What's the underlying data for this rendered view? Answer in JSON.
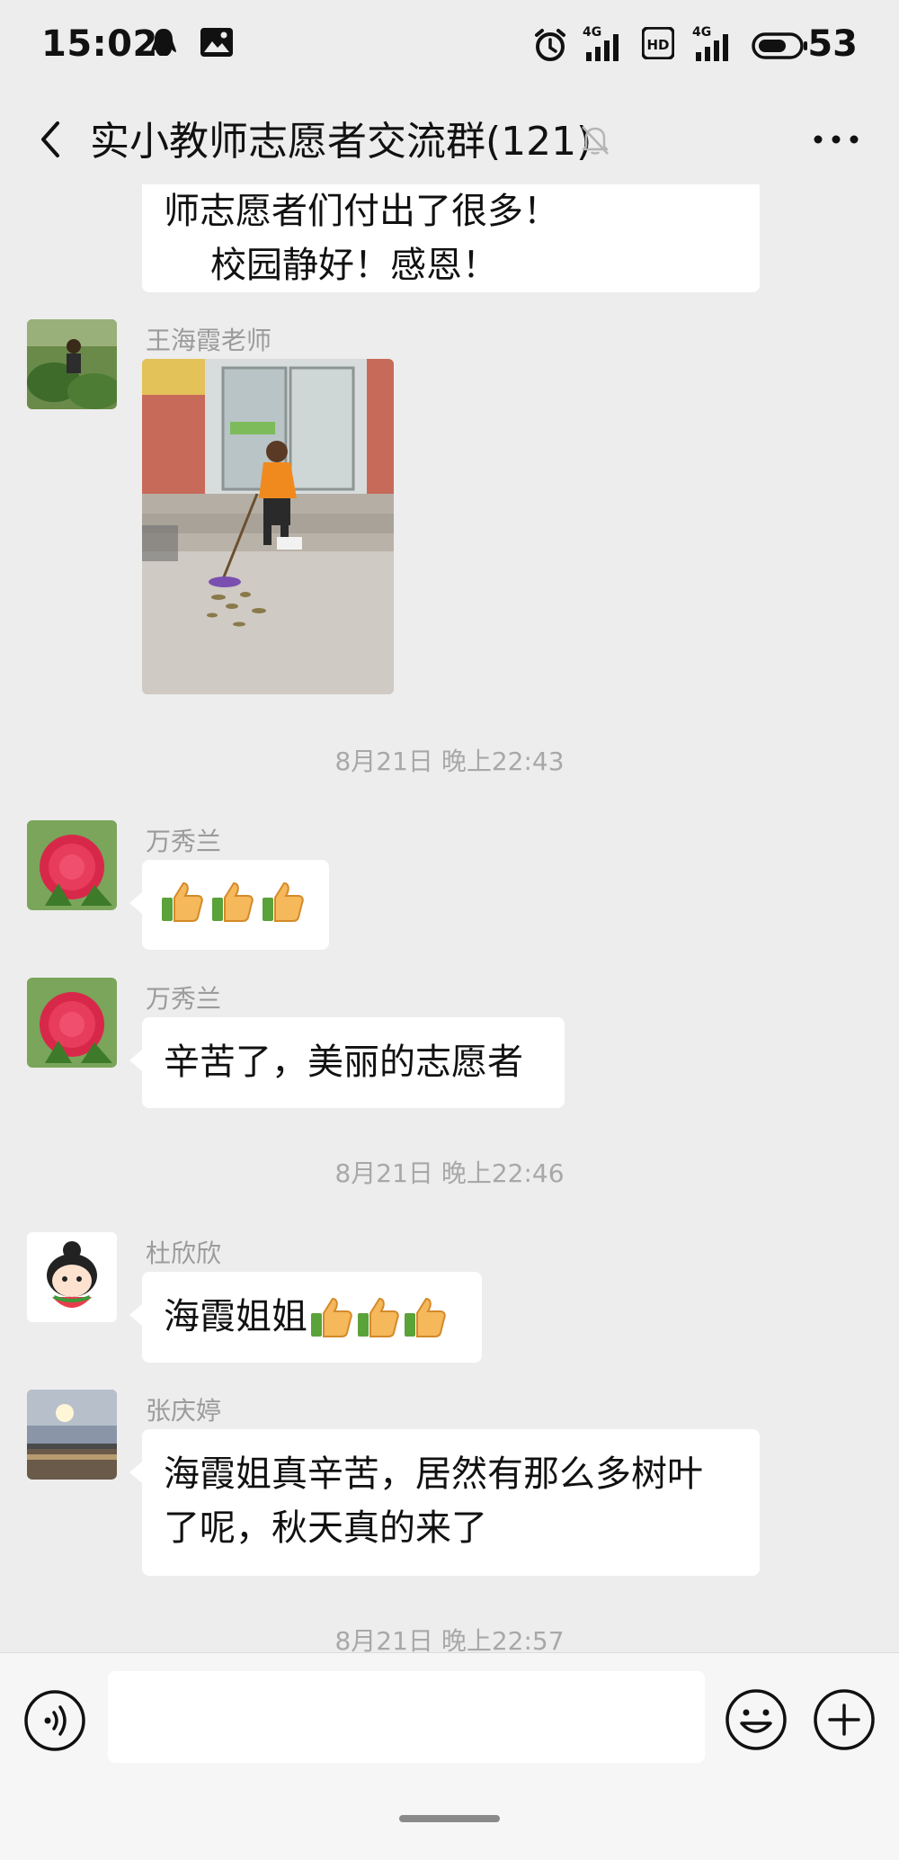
{
  "status_bar": {
    "time": "15:02",
    "network_1": "4G",
    "network_2": "4G",
    "hd": "HD",
    "battery": "53",
    "icons": [
      "qq-penguin-icon",
      "image-notify-icon",
      "alarm-icon",
      "signal-icon",
      "hd-icon",
      "signal-icon",
      "battery-icon"
    ]
  },
  "header": {
    "title": "实小教师志愿者交流群(121)",
    "back_icon": "chevron-left-icon",
    "mute_icon": "bell-off-icon",
    "more_icon": "more-dots-icon"
  },
  "messages": {
    "m0": {
      "line1": "师志愿者们付出了很多！",
      "line2": "校园静好！感恩！"
    },
    "m1": {
      "sender": "王海霞老师",
      "type": "image",
      "avatar": "gardening-photo"
    },
    "ts1": "8月21日 晚上22:43",
    "m2": {
      "sender": "万秀兰",
      "type": "emoji",
      "content": "👍👍👍",
      "avatar": "peony-flower"
    },
    "m3": {
      "sender": "万秀兰",
      "text": "辛苦了，美丽的志愿者",
      "avatar": "peony-flower"
    },
    "ts2": "8月21日 晚上22:46",
    "m4": {
      "sender": "杜欣欣",
      "text": "海霞姐姐",
      "suffix_emoji": "👍👍👍",
      "avatar": "cartoon-girl-watermelon"
    },
    "m5": {
      "sender": "张庆婷",
      "line1": "海霞姐真辛苦，居然有那么多树叶",
      "line2": "了呢，秋天真的来了",
      "avatar": "sunset-photo"
    },
    "ts3": "8月21日 晚上22:57"
  },
  "input_bar": {
    "text_value": "",
    "voice_icon": "voice-icon",
    "emoji_icon": "emoji-smile-icon",
    "plus_icon": "plus-circle-icon"
  },
  "colors": {
    "background": "#ededed",
    "bubble": "#ffffff",
    "meta_text": "#9b9b9b"
  }
}
